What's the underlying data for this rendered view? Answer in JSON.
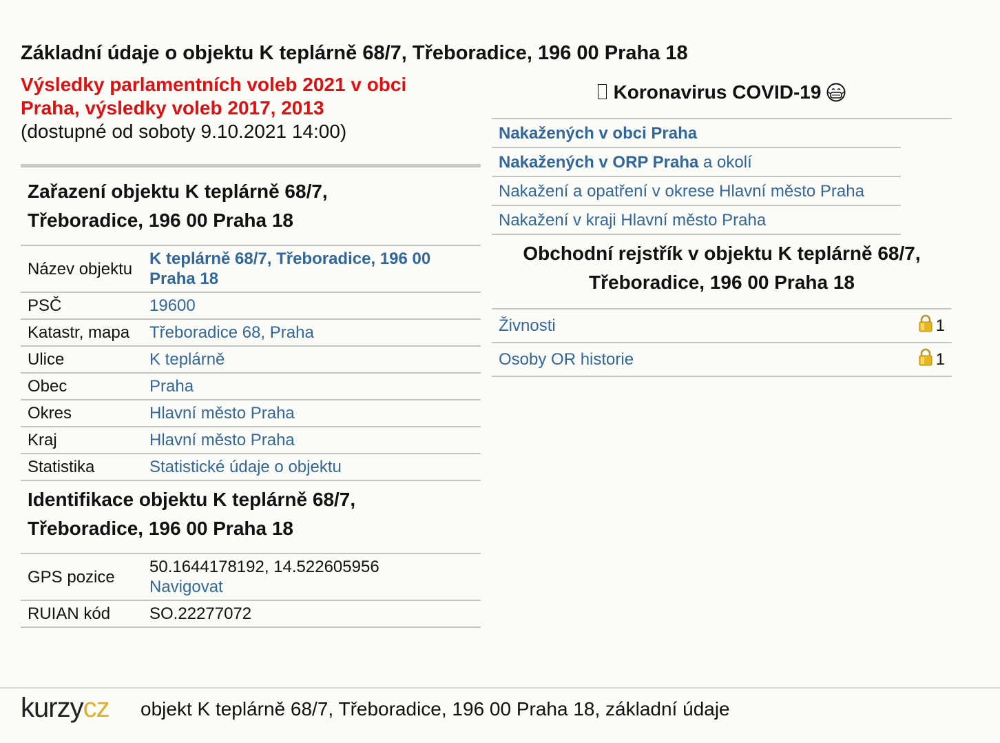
{
  "page": {
    "title": "Základní údaje o objektu K teplárně 68/7, Třeboradice, 196 00 Praha 18"
  },
  "elections": {
    "link_text": "Výsledky parlamentních voleb 2021 v obci Praha, výsledky voleb 2017, 2013",
    "availability": "(dostupné od soboty 9.10.2021 14:00)"
  },
  "classification": {
    "heading": "Zařazení objektu K teplárně 68/7, Třeboradice, 196 00 Praha 18",
    "rows": [
      {
        "label": "Název objektu",
        "value": "K teplárně 68/7, Třeboradice, 196 00 Praha 18"
      },
      {
        "label": "PSČ",
        "value": "19600"
      },
      {
        "label": "Katastr, mapa",
        "value": "Třeboradice 68, Praha"
      },
      {
        "label": "Ulice",
        "value": "K teplárně"
      },
      {
        "label": "Obec",
        "value": "Praha"
      },
      {
        "label": "Okres",
        "value": "Hlavní město Praha"
      },
      {
        "label": "Kraj",
        "value": "Hlavní město Praha"
      },
      {
        "label": "Statistika",
        "value": "Statistické údaje o objektu"
      }
    ]
  },
  "identification": {
    "heading": "Identifikace objektu K teplárně 68/7, Třeboradice, 196 00 Praha 18",
    "gps_label": "GPS pozice",
    "gps_value": "50.1644178192, 14.522605956",
    "navigate_link": "Navigovat",
    "ruian_label": "RUIAN kód",
    "ruian_value": "SO.22277072"
  },
  "covid": {
    "heading": "Koronavirus COVID-19",
    "items": [
      {
        "bold": "Nakažených v obci Praha",
        "rest": ""
      },
      {
        "bold": "Nakažených v ORP Praha",
        "rest": " a okolí"
      },
      {
        "bold": "",
        "rest": "Nakažení a opatření v okrese Hlavní město Praha"
      },
      {
        "bold": "",
        "rest": "Nakažení v kraji Hlavní město Praha"
      }
    ]
  },
  "business_register": {
    "heading": "Obchodní rejstřík v objektu K teplárně 68/7, Třeboradice, 196 00 Praha 18",
    "items": [
      {
        "label": "Živnosti",
        "count": "1",
        "icon": "lock-icon"
      },
      {
        "label": "Osoby OR historie",
        "count": "1",
        "icon": "lock-icon"
      }
    ]
  },
  "footer": {
    "logo_dark": "kurzy",
    "logo_accent": "cz",
    "text": "objekt K teplárně 68/7, Třeboradice, 196 00 Praha 18, základní údaje"
  },
  "colors": {
    "link": "#336699",
    "election_red": "#e01010",
    "logo_accent": "#e0b030",
    "lock_gold": "#e6b81e"
  }
}
